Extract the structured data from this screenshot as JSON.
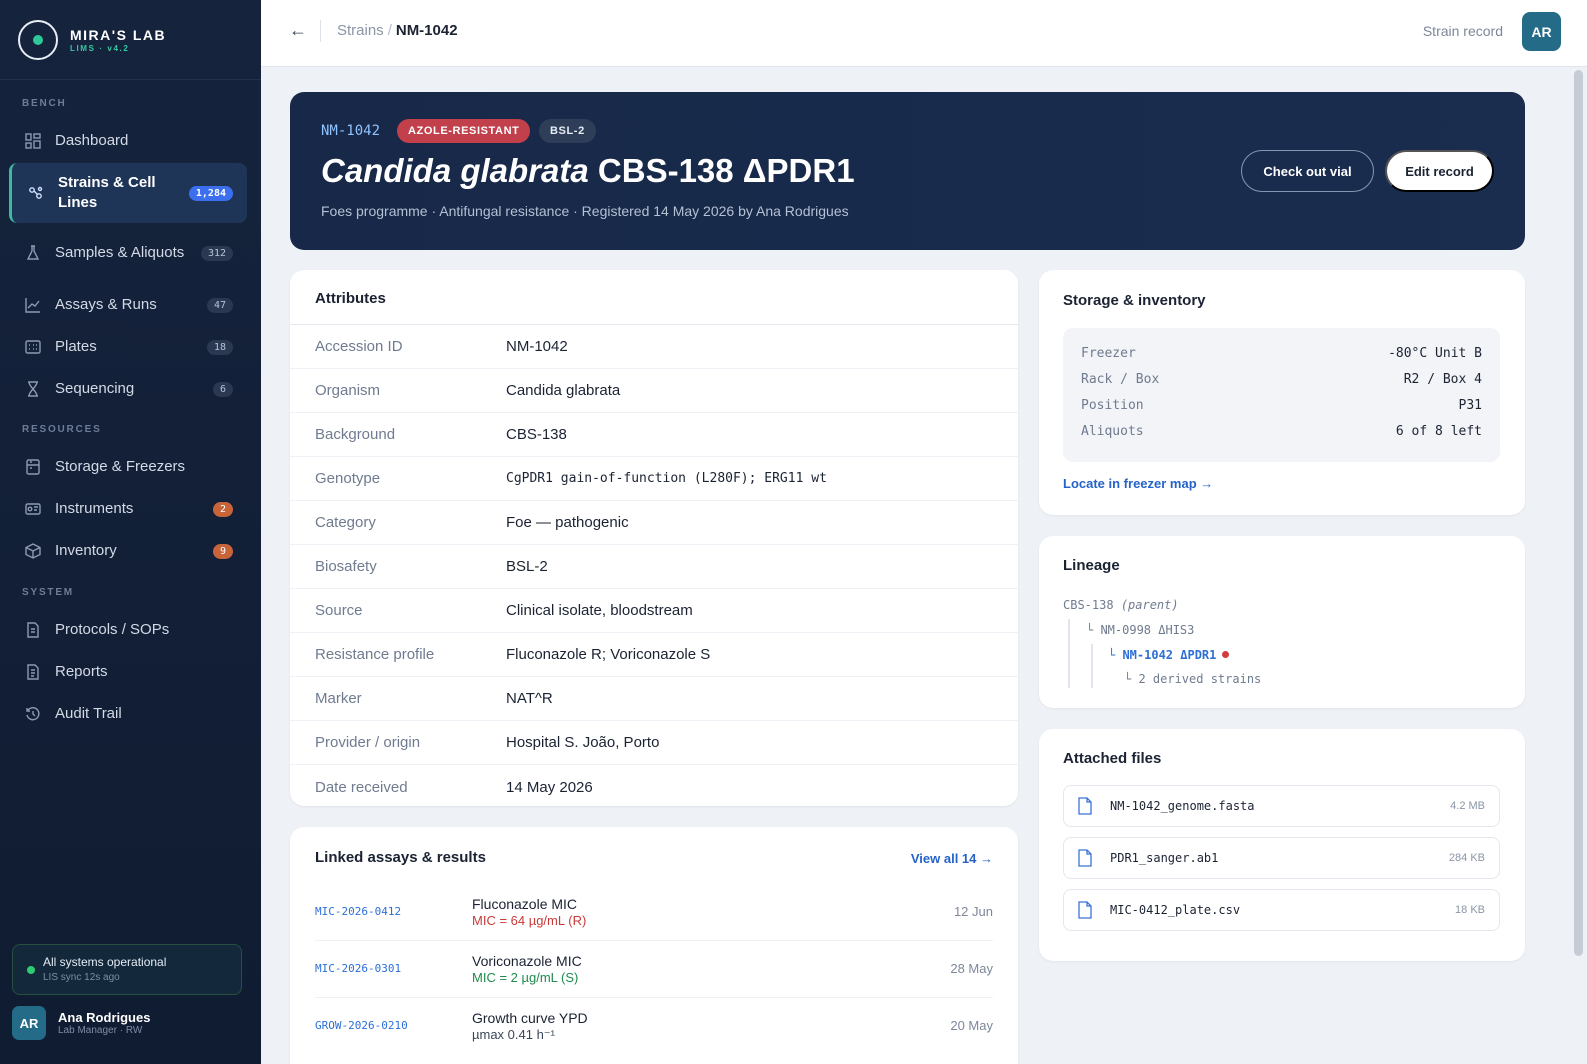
{
  "brand": {
    "name": "MIRA'S LAB",
    "sub": "LIMS · v4.2"
  },
  "sidebar": {
    "sections": {
      "bench": "BENCH",
      "resources": "RESOURCES",
      "system": "SYSTEM"
    },
    "items": [
      {
        "label": "Dashboard",
        "icon": "dashboard-icon"
      },
      {
        "label": "Strains & Cell Lines",
        "count": "1,284",
        "icon": "strains-icon"
      },
      {
        "label": "Samples & Aliquots",
        "count": "312",
        "icon": "flask-icon"
      },
      {
        "label": "Assays & Runs",
        "count": "47",
        "icon": "chart-icon"
      },
      {
        "label": "Plates",
        "count": "18",
        "icon": "plate-icon"
      },
      {
        "label": "Sequencing",
        "count": "6",
        "icon": "sequencing-icon"
      },
      {
        "label": "Storage & Freezers",
        "icon": "freezer-icon"
      },
      {
        "label": "Instruments",
        "count": "2",
        "icon": "instrument-icon"
      },
      {
        "label": "Inventory",
        "count": "9",
        "icon": "box-icon"
      },
      {
        "label": "Protocols / SOPs",
        "icon": "document-icon"
      },
      {
        "label": "Reports",
        "icon": "report-icon"
      },
      {
        "label": "Audit Trail",
        "icon": "history-icon"
      }
    ],
    "status": {
      "title": "All systems operational",
      "sub": "LIS sync 12s ago"
    },
    "user": {
      "initials": "AR",
      "name": "Ana Rodrigues",
      "role": "Lab Manager · RW"
    }
  },
  "topbar": {
    "breadcrumb": {
      "parent": "Strains",
      "separator": "/",
      "current": "NM-1042"
    },
    "right_label": "Strain record",
    "avatar": "AR"
  },
  "hero": {
    "id": "NM-1042",
    "tag_resistance": "AZOLE-RESISTANT",
    "tag_biosafety": "BSL-2",
    "title_italic": "Candida glabrata",
    "title_rest": "CBS-138 ΔPDR1",
    "meta": "Foes programme · Antifungal resistance · Registered 14 May 2026 by Ana Rodrigues",
    "btn_checkout": "Check out vial",
    "btn_edit": "Edit record"
  },
  "attributes": {
    "title": "Attributes",
    "rows": [
      {
        "key": "Accession ID",
        "value": "NM-1042"
      },
      {
        "key": "Organism",
        "value": "Candida glabrata"
      },
      {
        "key": "Background",
        "value": "CBS-138"
      },
      {
        "key": "Genotype",
        "value": "CgPDR1 gain-of-function (L280F); ERG11 wt"
      },
      {
        "key": "Category",
        "value": "Foe — pathogenic"
      },
      {
        "key": "Biosafety",
        "value": "BSL-2"
      },
      {
        "key": "Source",
        "value": "Clinical isolate, bloodstream"
      },
      {
        "key": "Resistance profile",
        "value": "Fluconazole R; Voriconazole S"
      },
      {
        "key": "Marker",
        "value": "NAT^R"
      },
      {
        "key": "Provider / origin",
        "value": "Hospital S. João, Porto"
      },
      {
        "key": "Date received",
        "value": "14 May 2026"
      }
    ]
  },
  "assays": {
    "title": "Linked assays & results",
    "view_all": "View all 14 →",
    "rows": [
      {
        "id": "MIC-2026-0412",
        "name": "Fluconazole MIC",
        "result": "MIC = 64 µg/mL (R)",
        "result_color": "#c83a3a",
        "date": "12 Jun"
      },
      {
        "id": "MIC-2026-0301",
        "name": "Voriconazole MIC",
        "result": "MIC = 2 µg/mL (S)",
        "result_color": "#1f8a4c",
        "date": "28 May"
      },
      {
        "id": "GROW-2026-0210",
        "name": "Growth curve YPD",
        "result": "µmax 0.41 h⁻¹",
        "result_color": "#3a4659",
        "date": "20 May"
      }
    ]
  },
  "storage": {
    "title": "Storage & inventory",
    "rows": [
      {
        "key": "Freezer",
        "value": "-80°C Unit B"
      },
      {
        "key": "Rack / Box",
        "value": "R2 / Box 4"
      },
      {
        "key": "Position",
        "value": "P31"
      },
      {
        "key": "Aliquots",
        "value": "6 of 8 left"
      }
    ],
    "locate": "Locate in freezer map →"
  },
  "lineage": {
    "title": "Lineage",
    "root": "CBS-138",
    "root_note": "(parent)",
    "child": "└ NM-0998 ΔHIS3",
    "current": "└ NM-1042 ΔPDR1",
    "derived": "└ 2 derived strains"
  },
  "files": {
    "title": "Attached files",
    "items": [
      {
        "name": "NM-1042_genome.fasta",
        "size": "4.2 MB"
      },
      {
        "name": "PDR1_sanger.ab1",
        "size": "284 KB"
      },
      {
        "name": "MIC-0412_plate.csv",
        "size": "18 KB"
      }
    ]
  },
  "colors": {
    "accent": "#2563c9",
    "hero_bg": "#172848",
    "danger": "#c2404b",
    "success": "#2ecc71"
  }
}
